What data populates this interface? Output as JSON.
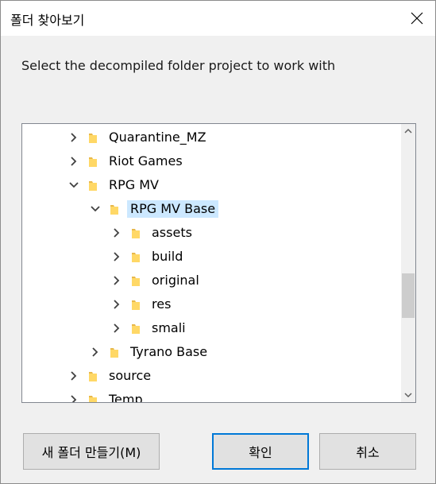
{
  "dialog": {
    "title": "폴더 찾아보기",
    "prompt": "Select the decompiled folder project to work with"
  },
  "tree": {
    "items": [
      {
        "label": "Quarantine_MZ",
        "depth": 0,
        "expanded": false,
        "selected": false
      },
      {
        "label": "Riot Games",
        "depth": 0,
        "expanded": false,
        "selected": false
      },
      {
        "label": "RPG MV",
        "depth": 0,
        "expanded": true,
        "selected": false
      },
      {
        "label": "RPG MV Base",
        "depth": 1,
        "expanded": true,
        "selected": true
      },
      {
        "label": "assets",
        "depth": 2,
        "expanded": false,
        "selected": false
      },
      {
        "label": "build",
        "depth": 2,
        "expanded": false,
        "selected": false
      },
      {
        "label": "original",
        "depth": 2,
        "expanded": false,
        "selected": false
      },
      {
        "label": "res",
        "depth": 2,
        "expanded": false,
        "selected": false
      },
      {
        "label": "smali",
        "depth": 2,
        "expanded": false,
        "selected": false
      },
      {
        "label": "Tyrano Base",
        "depth": 1,
        "expanded": false,
        "selected": false
      },
      {
        "label": "source",
        "depth": 0,
        "expanded": false,
        "selected": false
      },
      {
        "label": "Temp",
        "depth": 0,
        "expanded": false,
        "selected": false
      }
    ]
  },
  "buttons": {
    "new_folder": "새 폴더 만들기(M)",
    "ok": "확인",
    "cancel": "취소"
  },
  "colors": {
    "selection": "#cce8ff",
    "folder": "#ffd866",
    "accent": "#0078d7"
  }
}
